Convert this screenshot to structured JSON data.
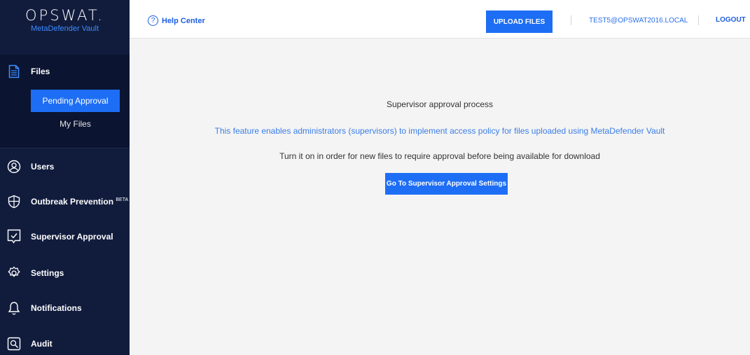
{
  "brand": {
    "name": "OPSWAT.",
    "product": "MetaDefender Vault"
  },
  "sidebar": {
    "files": {
      "label": "Files",
      "icon": "document-icon",
      "subitems": [
        {
          "label": "Pending Approval",
          "active": true
        },
        {
          "label": "My Files",
          "active": false
        }
      ]
    },
    "items": [
      {
        "label": "Users",
        "icon": "users-icon"
      },
      {
        "label": "Outbreak Prevention",
        "sup": "BETA",
        "icon": "shield-icon"
      },
      {
        "label": "Supervisor Approval",
        "icon": "approval-icon"
      },
      {
        "label": "Settings",
        "icon": "gear-icon"
      },
      {
        "label": "Notifications",
        "icon": "bell-icon"
      },
      {
        "label": "Audit",
        "icon": "audit-icon"
      }
    ]
  },
  "topbar": {
    "help_label": "Help Center",
    "help_icon": "?",
    "upload_label": "UPLOAD FILES",
    "user_email": "TEST5@OPSWAT2016.LOCAL",
    "logout_label": "LOGOUT"
  },
  "main": {
    "title": "Supervisor approval process",
    "description": "This feature enables administrators (supervisors) to implement access policy for files uploaded using MetaDefender Vault",
    "instruction": "Turn it on in order for new files to require approval before being available for download",
    "button_label": "Go To Supervisor Approval Settings"
  },
  "colors": {
    "sidebar_bg": "#111c3d",
    "accent": "#1d6ef5",
    "link": "#3a7ee8"
  }
}
